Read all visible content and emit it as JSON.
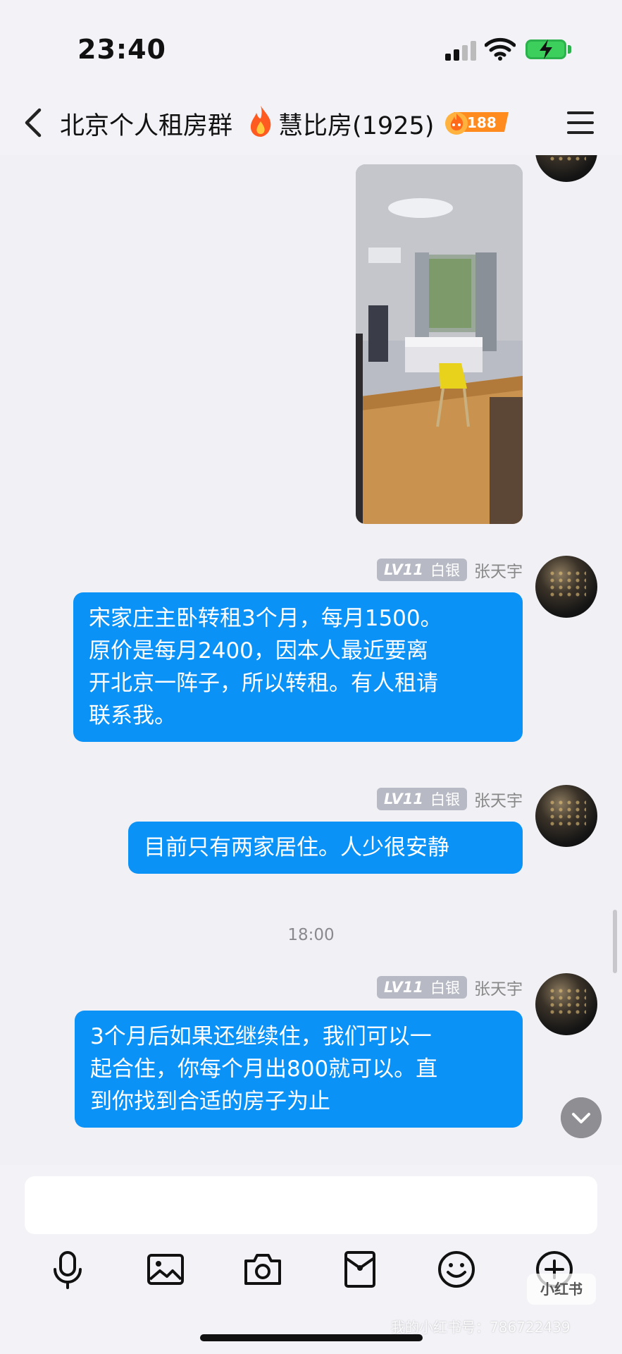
{
  "status": {
    "time": "23:40"
  },
  "header": {
    "title_part1": "北京个人租房群",
    "title_part2": "慧比房(1925)",
    "badge_count": "188"
  },
  "chat": {
    "messages": [
      {
        "sender": "张天宇",
        "level": "LV11",
        "rank": "白银",
        "text": "宋家庄主卧转租3个月，每月1500。\n原价是每月2400，因本人最近要离\n开北京一阵子，所以转租。有人租请\n联系我。"
      },
      {
        "sender": "张天宇",
        "level": "LV11",
        "rank": "白银",
        "text": "目前只有两家居住。人少很安静"
      },
      {
        "sender": "张天宇",
        "level": "LV11",
        "rank": "白银",
        "text": "3个月后如果还继续住，我们可以一\n起合住，你每个月出800就可以。直\n到你找到合适的房子为止"
      }
    ],
    "timestamp": "18:00"
  },
  "input": {
    "placeholder": "",
    "tools": [
      "microphone-icon",
      "image-icon",
      "camera-icon",
      "red-packet-icon",
      "emoji-icon",
      "plus-icon"
    ]
  },
  "watermark": {
    "text": "我的小红书号：786722439",
    "logo": "小红书"
  },
  "colors": {
    "bubble": "#0a92f7",
    "background": "#f0f0f5",
    "badge": "#b7bac4"
  }
}
